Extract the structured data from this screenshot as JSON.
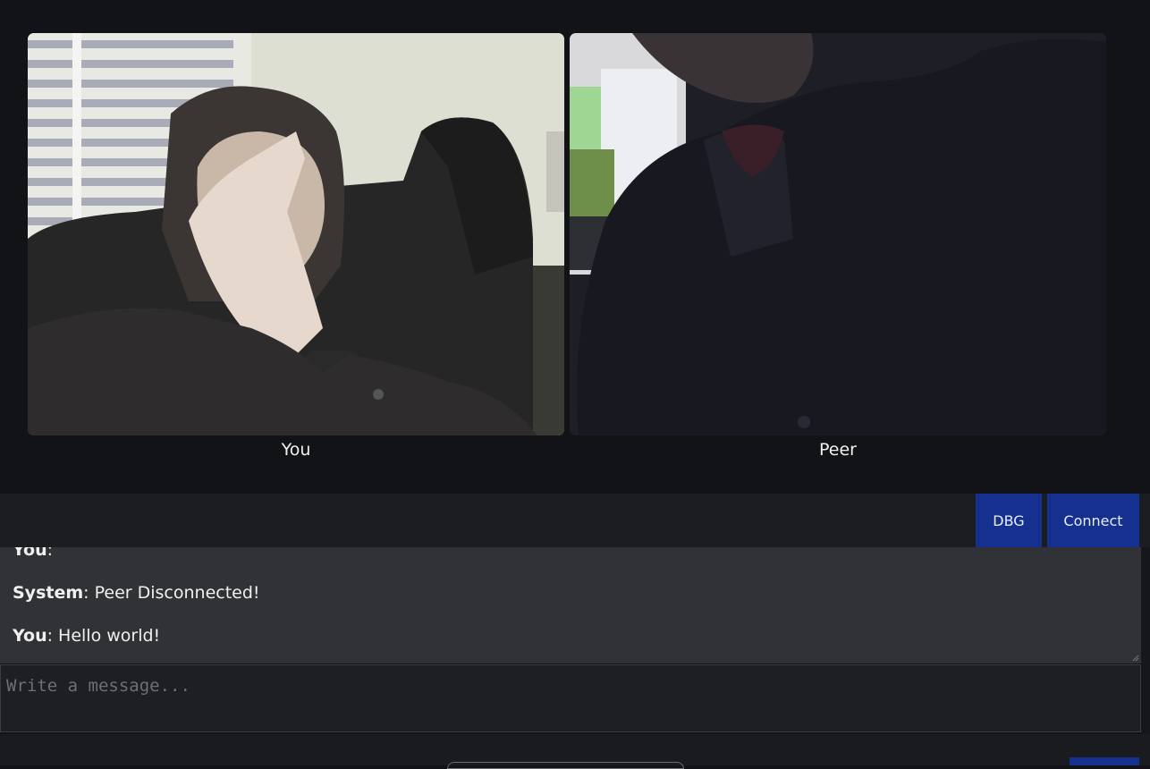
{
  "videos": {
    "local_label": "You",
    "remote_label": "Peer"
  },
  "toolbar": {
    "dbg_label": "DBG",
    "connect_label": "Connect"
  },
  "chat": {
    "messages": [
      {
        "sender": "You",
        "text": ""
      },
      {
        "sender": "System",
        "text": " Peer Disconnected!"
      },
      {
        "sender": "You",
        "text": " Hello world!"
      }
    ]
  },
  "composer": {
    "placeholder": "Write a message..."
  },
  "colors": {
    "accent": "#15308e",
    "background": "#121316",
    "chat_background": "#303236"
  }
}
